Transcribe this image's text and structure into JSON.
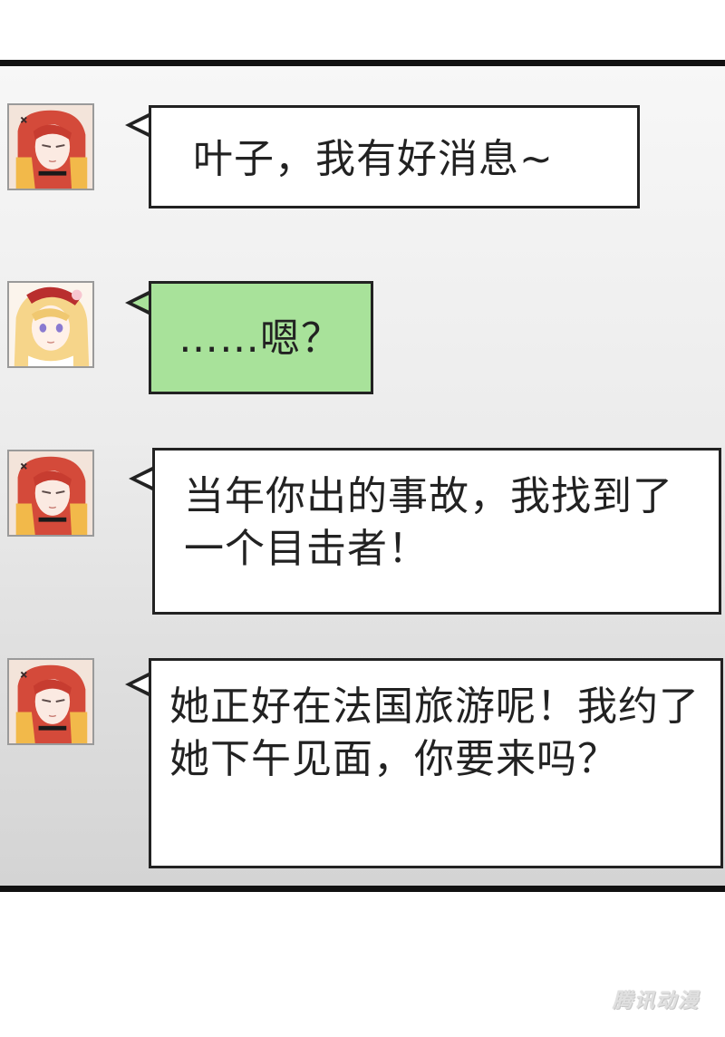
{
  "messages": [
    {
      "sender": "red-haired man",
      "text": "叶子，我有好消息~",
      "bubble_color": "#ffffff"
    },
    {
      "sender": "blonde girl",
      "text": "……嗯？",
      "bubble_color": "#a8e29a"
    },
    {
      "sender": "red-haired man",
      "text": "当年你出的事故，我找到了一个目击者！",
      "bubble_color": "#ffffff"
    },
    {
      "sender": "red-haired man",
      "text": "她正好在法国旅游呢！我约了她下午见面，你要来吗？",
      "bubble_color": "#ffffff"
    }
  ],
  "watermark": "腾讯动漫",
  "colors": {
    "panel_border": "#111111",
    "bubble_border": "#222222",
    "green_bubble": "#a8e29a"
  }
}
